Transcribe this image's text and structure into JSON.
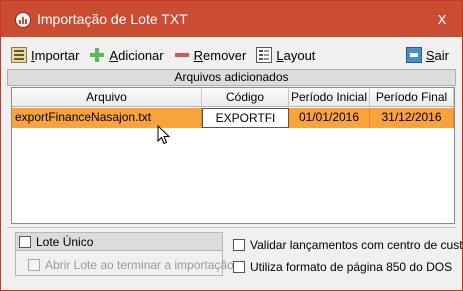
{
  "window": {
    "title": "Importação de Lote TXT",
    "close_label": "x"
  },
  "toolbar": {
    "importar": "Importar",
    "adicionar": "Adicionar",
    "remover": "Remover",
    "layout": "Layout",
    "sair": "Sair"
  },
  "section": {
    "title": "Arquivos adicionados"
  },
  "grid": {
    "columns": [
      "Arquivo",
      "Código",
      "Período Inicial",
      "Período Final"
    ],
    "rows": [
      {
        "arquivo": "exportFinanceNasajon.txt",
        "codigo": "EXPORTFI",
        "inicio": "01/01/2016",
        "fim": "31/12/2016"
      }
    ],
    "selected_color": "#f8a33c"
  },
  "options": {
    "lote_unico": "Lote Único",
    "abrir_lote": "Abrir Lote ao terminar a importação",
    "validar": "Validar lançamentos com centro de custo",
    "formato": "Utiliza formato de página 850 do DOS"
  },
  "colors": {
    "titlebar": "#c94c33",
    "row_highlight": "#f8a33c"
  }
}
